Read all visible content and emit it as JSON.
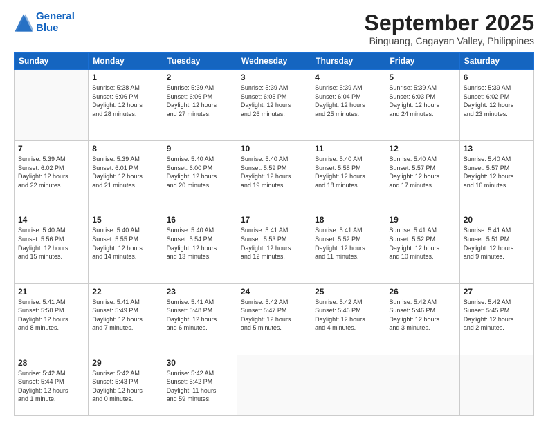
{
  "logo": {
    "line1": "General",
    "line2": "Blue"
  },
  "title": "September 2025",
  "location": "Binguang, Cagayan Valley, Philippines",
  "weekdays": [
    "Sunday",
    "Monday",
    "Tuesday",
    "Wednesday",
    "Thursday",
    "Friday",
    "Saturday"
  ],
  "weeks": [
    [
      {
        "day": "",
        "info": ""
      },
      {
        "day": "1",
        "info": "Sunrise: 5:38 AM\nSunset: 6:06 PM\nDaylight: 12 hours\nand 28 minutes."
      },
      {
        "day": "2",
        "info": "Sunrise: 5:39 AM\nSunset: 6:06 PM\nDaylight: 12 hours\nand 27 minutes."
      },
      {
        "day": "3",
        "info": "Sunrise: 5:39 AM\nSunset: 6:05 PM\nDaylight: 12 hours\nand 26 minutes."
      },
      {
        "day": "4",
        "info": "Sunrise: 5:39 AM\nSunset: 6:04 PM\nDaylight: 12 hours\nand 25 minutes."
      },
      {
        "day": "5",
        "info": "Sunrise: 5:39 AM\nSunset: 6:03 PM\nDaylight: 12 hours\nand 24 minutes."
      },
      {
        "day": "6",
        "info": "Sunrise: 5:39 AM\nSunset: 6:02 PM\nDaylight: 12 hours\nand 23 minutes."
      }
    ],
    [
      {
        "day": "7",
        "info": "Sunrise: 5:39 AM\nSunset: 6:02 PM\nDaylight: 12 hours\nand 22 minutes."
      },
      {
        "day": "8",
        "info": "Sunrise: 5:39 AM\nSunset: 6:01 PM\nDaylight: 12 hours\nand 21 minutes."
      },
      {
        "day": "9",
        "info": "Sunrise: 5:40 AM\nSunset: 6:00 PM\nDaylight: 12 hours\nand 20 minutes."
      },
      {
        "day": "10",
        "info": "Sunrise: 5:40 AM\nSunset: 5:59 PM\nDaylight: 12 hours\nand 19 minutes."
      },
      {
        "day": "11",
        "info": "Sunrise: 5:40 AM\nSunset: 5:58 PM\nDaylight: 12 hours\nand 18 minutes."
      },
      {
        "day": "12",
        "info": "Sunrise: 5:40 AM\nSunset: 5:57 PM\nDaylight: 12 hours\nand 17 minutes."
      },
      {
        "day": "13",
        "info": "Sunrise: 5:40 AM\nSunset: 5:57 PM\nDaylight: 12 hours\nand 16 minutes."
      }
    ],
    [
      {
        "day": "14",
        "info": "Sunrise: 5:40 AM\nSunset: 5:56 PM\nDaylight: 12 hours\nand 15 minutes."
      },
      {
        "day": "15",
        "info": "Sunrise: 5:40 AM\nSunset: 5:55 PM\nDaylight: 12 hours\nand 14 minutes."
      },
      {
        "day": "16",
        "info": "Sunrise: 5:40 AM\nSunset: 5:54 PM\nDaylight: 12 hours\nand 13 minutes."
      },
      {
        "day": "17",
        "info": "Sunrise: 5:41 AM\nSunset: 5:53 PM\nDaylight: 12 hours\nand 12 minutes."
      },
      {
        "day": "18",
        "info": "Sunrise: 5:41 AM\nSunset: 5:52 PM\nDaylight: 12 hours\nand 11 minutes."
      },
      {
        "day": "19",
        "info": "Sunrise: 5:41 AM\nSunset: 5:52 PM\nDaylight: 12 hours\nand 10 minutes."
      },
      {
        "day": "20",
        "info": "Sunrise: 5:41 AM\nSunset: 5:51 PM\nDaylight: 12 hours\nand 9 minutes."
      }
    ],
    [
      {
        "day": "21",
        "info": "Sunrise: 5:41 AM\nSunset: 5:50 PM\nDaylight: 12 hours\nand 8 minutes."
      },
      {
        "day": "22",
        "info": "Sunrise: 5:41 AM\nSunset: 5:49 PM\nDaylight: 12 hours\nand 7 minutes."
      },
      {
        "day": "23",
        "info": "Sunrise: 5:41 AM\nSunset: 5:48 PM\nDaylight: 12 hours\nand 6 minutes."
      },
      {
        "day": "24",
        "info": "Sunrise: 5:42 AM\nSunset: 5:47 PM\nDaylight: 12 hours\nand 5 minutes."
      },
      {
        "day": "25",
        "info": "Sunrise: 5:42 AM\nSunset: 5:46 PM\nDaylight: 12 hours\nand 4 minutes."
      },
      {
        "day": "26",
        "info": "Sunrise: 5:42 AM\nSunset: 5:46 PM\nDaylight: 12 hours\nand 3 minutes."
      },
      {
        "day": "27",
        "info": "Sunrise: 5:42 AM\nSunset: 5:45 PM\nDaylight: 12 hours\nand 2 minutes."
      }
    ],
    [
      {
        "day": "28",
        "info": "Sunrise: 5:42 AM\nSunset: 5:44 PM\nDaylight: 12 hours\nand 1 minute."
      },
      {
        "day": "29",
        "info": "Sunrise: 5:42 AM\nSunset: 5:43 PM\nDaylight: 12 hours\nand 0 minutes."
      },
      {
        "day": "30",
        "info": "Sunrise: 5:42 AM\nSunset: 5:42 PM\nDaylight: 11 hours\nand 59 minutes."
      },
      {
        "day": "",
        "info": ""
      },
      {
        "day": "",
        "info": ""
      },
      {
        "day": "",
        "info": ""
      },
      {
        "day": "",
        "info": ""
      }
    ]
  ]
}
